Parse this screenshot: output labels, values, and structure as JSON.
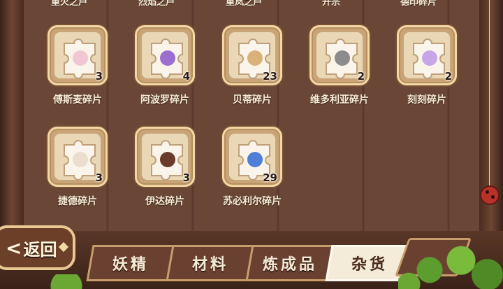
{
  "top_row_labels": [
    "重火之芦",
    "烈焰之芦",
    "重岚之芦",
    "开宗",
    "德印碎片"
  ],
  "items": [
    {
      "name": "傅斯麦碎片",
      "count": "3",
      "color": "#f1c7d4"
    },
    {
      "name": "阿波罗碎片",
      "count": "4",
      "color": "#9b6fd0"
    },
    {
      "name": "贝蒂碎片",
      "count": "23",
      "color": "#d9b27a"
    },
    {
      "name": "维多利亚碎片",
      "count": "2",
      "color": "#8c8c8c"
    },
    {
      "name": "刻刻碎片",
      "count": "2",
      "color": "#c6a6e6"
    },
    {
      "name": "捷德碎片",
      "count": "3",
      "color": "#eadfcf"
    },
    {
      "name": "伊达碎片",
      "count": "3",
      "color": "#6a3a2a"
    },
    {
      "name": "苏必利尔碎片",
      "count": "29",
      "color": "#4f7fd6"
    }
  ],
  "back_button": {
    "arrow": "<",
    "label": "返回"
  },
  "tabs": [
    {
      "label": "妖精",
      "active": false
    },
    {
      "label": "材料",
      "active": false
    },
    {
      "label": "炼成品",
      "active": false
    },
    {
      "label": "杂货",
      "active": true
    }
  ]
}
